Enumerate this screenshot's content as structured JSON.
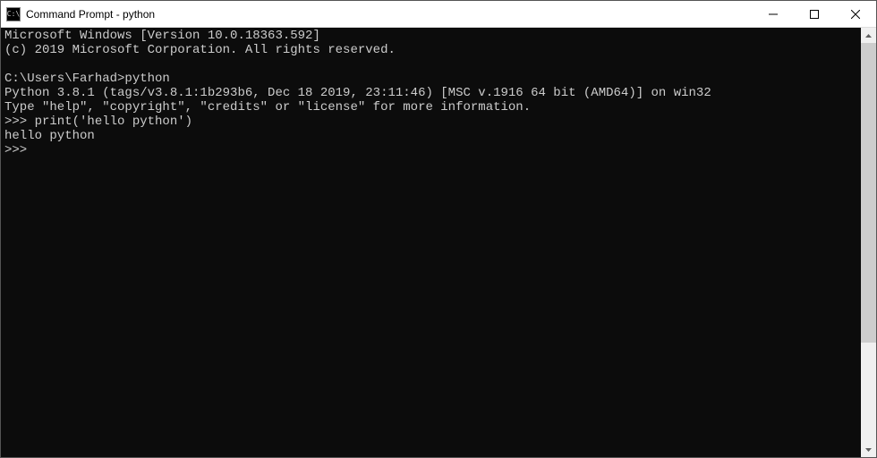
{
  "window": {
    "title": "Command Prompt - python"
  },
  "terminal": {
    "lines": [
      "Microsoft Windows [Version 10.0.18363.592]",
      "(c) 2019 Microsoft Corporation. All rights reserved.",
      "",
      "C:\\Users\\Farhad>python",
      "Python 3.8.1 (tags/v3.8.1:1b293b6, Dec 18 2019, 23:11:46) [MSC v.1916 64 bit (AMD64)] on win32",
      "Type \"help\", \"copyright\", \"credits\" or \"license\" for more information.",
      ">>> print('hello python')",
      "hello python",
      ">>>"
    ]
  }
}
